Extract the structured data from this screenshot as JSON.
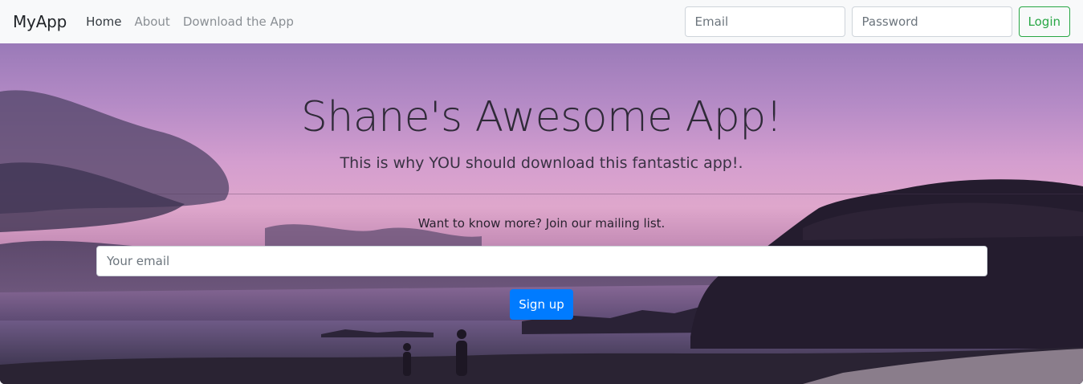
{
  "navbar": {
    "brand": "MyApp",
    "links": [
      {
        "label": "Home",
        "active": true
      },
      {
        "label": "About",
        "active": false
      },
      {
        "label": "Download the App",
        "active": false
      }
    ],
    "email_placeholder": "Email",
    "password_placeholder": "Password",
    "login_label": "Login"
  },
  "hero": {
    "title": "Shane's Awesome App!",
    "lead": "This is why YOU should download this fantastic app!.",
    "cta_text": "Want to know more? Join our mailing list.",
    "email_placeholder": "Your email",
    "signup_label": "Sign up"
  },
  "colors": {
    "primary": "#007bff",
    "success": "#28a745",
    "navbar_bg": "#f8f9fa"
  }
}
